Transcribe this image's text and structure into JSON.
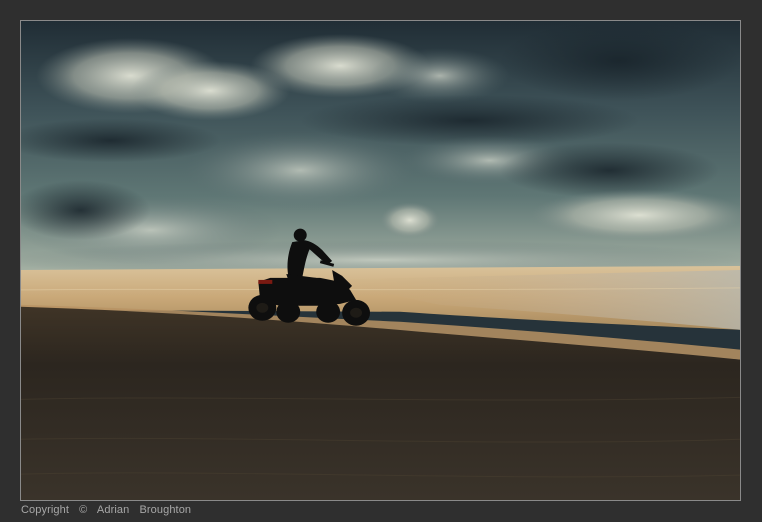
{
  "photo": {
    "subject": "atv-rider-silhouette-on-dunes",
    "palette": {
      "sky_dark": "#1f2b33",
      "sky_mid": "#4f6469",
      "cloud_light": "#d3d6c8",
      "sand_lit": "#d8bd92",
      "sand_shadow": "#2c261f",
      "frame": "#2f2f2f",
      "caption": "#a7a7a7"
    }
  },
  "caption": {
    "label": "Copyright",
    "symbol": "©",
    "author_first": "Adrian",
    "author_last": "Broughton"
  }
}
